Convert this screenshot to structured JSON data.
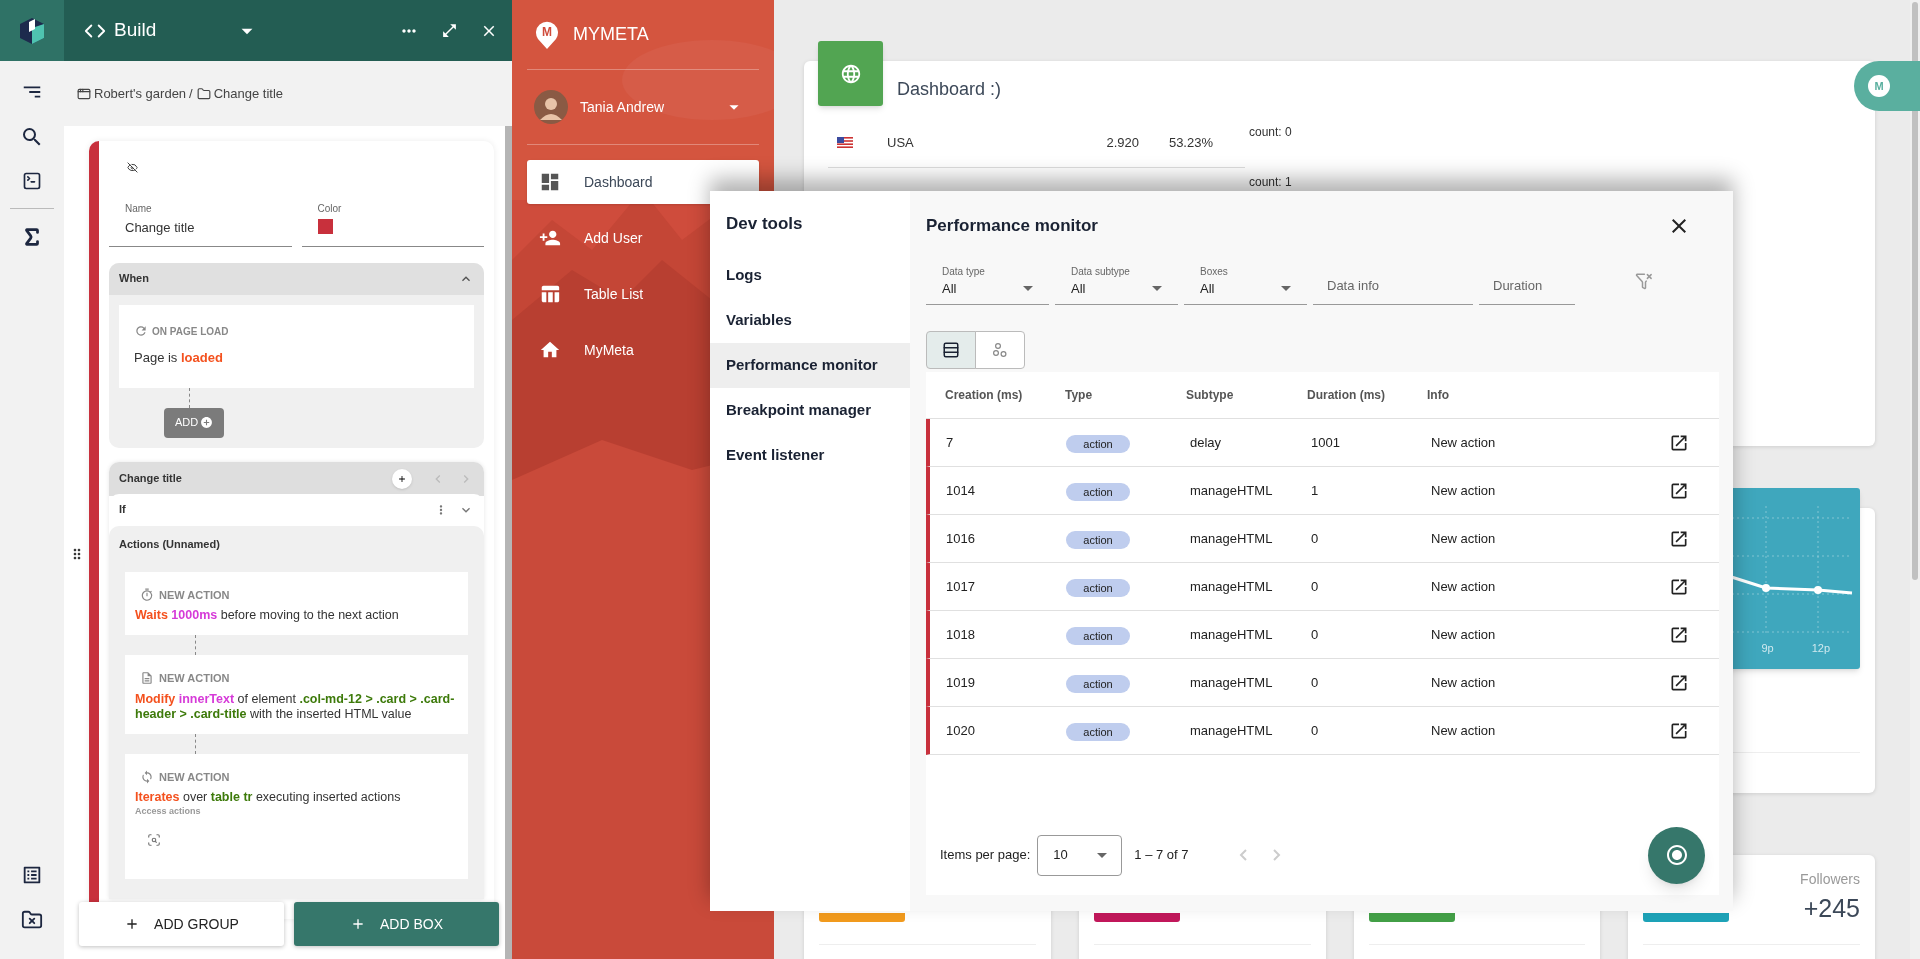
{
  "builder": {
    "title": "Build",
    "breadcrumb": {
      "items": [
        "Robert's garden",
        "Change title"
      ],
      "separator": "/"
    },
    "flow": {
      "name_label": "Name",
      "name_value": "Change title",
      "color_label": "Color",
      "color": "#c8303c",
      "when": {
        "title": "When",
        "expanded": true,
        "trigger": {
          "label": "ON PAGE LOAD",
          "text": [
            {
              "kind": "plain",
              "text": "Page is "
            },
            {
              "kind": "verb",
              "text": "loaded"
            }
          ]
        },
        "add_label": "ADD"
      },
      "group": {
        "title": "Change title",
        "condition": "If",
        "actions_title": "Actions (Unnamed)",
        "actions": [
          {
            "kind": "delay",
            "label": "NEW ACTION",
            "text": [
              {
                "kind": "verb",
                "text": "Waits "
              },
              {
                "kind": "value",
                "text": "1000ms"
              },
              {
                "kind": "plain",
                "text": " before moving to the next action"
              }
            ]
          },
          {
            "kind": "html",
            "label": "NEW ACTION",
            "text": [
              {
                "kind": "verb",
                "text": "Modify "
              },
              {
                "kind": "value",
                "text": "innerText"
              },
              {
                "kind": "plain",
                "text": " of element "
              },
              {
                "kind": "selector",
                "text": ".col-md-12 > .card > .card-header > .card-title"
              },
              {
                "kind": "plain",
                "text": " with the inserted HTML value"
              }
            ]
          },
          {
            "kind": "loop",
            "label": "NEW ACTION",
            "text": [
              {
                "kind": "verb",
                "text": "Iterates"
              },
              {
                "kind": "plain",
                "text": " over "
              },
              {
                "kind": "selector",
                "text": "table tr"
              },
              {
                "kind": "plain",
                "text": " executing inserted actions"
              }
            ],
            "sub": "Access actions"
          }
        ]
      }
    },
    "buttons": [
      {
        "kind": "secondary",
        "label": "ADD GROUP"
      },
      {
        "kind": "primary",
        "label": "ADD BOX"
      }
    ]
  },
  "sidebar": {
    "logo_letter": "M",
    "brand": "MYMETA",
    "user": "Tania Andrew",
    "nav": [
      {
        "kind": "dashboard",
        "label": "Dashboard",
        "selected": true
      },
      {
        "kind": "add_user",
        "label": "Add User",
        "selected": false
      },
      {
        "kind": "table",
        "label": "Table List",
        "selected": false
      },
      {
        "kind": "home",
        "label": "MyMeta",
        "selected": false
      }
    ]
  },
  "dashboard": {
    "title": "Dashboard :)",
    "rows": [
      {
        "country": "USA",
        "value": "2.920",
        "percent": "53.23%",
        "count": "count: 0"
      },
      {
        "count": "count: 1"
      }
    ]
  },
  "chart_card": {
    "labels": [
      "9p",
      "12p"
    ]
  },
  "stat_cards": [
    {
      "color": "#f29b1e"
    },
    {
      "color": "#c2185b"
    },
    {
      "color": "#43a047"
    },
    {
      "color": "#1ea3b8",
      "title": "Followers",
      "value": "+245"
    }
  ],
  "floating_badge": {
    "letter": "M"
  },
  "devtools": {
    "title": "Dev tools",
    "nav": [
      {
        "label": "Logs",
        "selected": false
      },
      {
        "label": "Variables",
        "selected": false
      },
      {
        "label": "Performance monitor",
        "selected": true
      },
      {
        "label": "Breakpoint manager",
        "selected": false
      },
      {
        "label": "Event listener",
        "selected": false
      }
    ],
    "panel": {
      "title": "Performance monitor",
      "filters": [
        {
          "kind": "select",
          "label": "Data type",
          "value": "All"
        },
        {
          "kind": "select",
          "label": "Data subtype",
          "value": "All"
        },
        {
          "kind": "select",
          "label": "Boxes",
          "value": "All"
        },
        {
          "kind": "text",
          "placeholder": "Data info"
        },
        {
          "kind": "text",
          "placeholder": "Duration"
        }
      ],
      "views": [
        {
          "kind": "table",
          "selected": true
        },
        {
          "kind": "graph",
          "selected": false
        }
      ],
      "columns": [
        "Creation (ms)",
        "Type",
        "Subtype",
        "Duration (ms)",
        "Info"
      ],
      "rows": [
        {
          "creation": "7",
          "type": "action",
          "subtype": "delay",
          "duration": "1001",
          "info": "New action"
        },
        {
          "creation": "1014",
          "type": "action",
          "subtype": "manageHTML",
          "duration": "1",
          "info": "New action"
        },
        {
          "creation": "1016",
          "type": "action",
          "subtype": "manageHTML",
          "duration": "0",
          "info": "New action"
        },
        {
          "creation": "1017",
          "type": "action",
          "subtype": "manageHTML",
          "duration": "0",
          "info": "New action"
        },
        {
          "creation": "1018",
          "type": "action",
          "subtype": "manageHTML",
          "duration": "0",
          "info": "New action"
        },
        {
          "creation": "1019",
          "type": "action",
          "subtype": "manageHTML",
          "duration": "0",
          "info": "New action"
        },
        {
          "creation": "1020",
          "type": "action",
          "subtype": "manageHTML",
          "duration": "0",
          "info": "New action"
        }
      ],
      "pagination": {
        "label": "Items per page:",
        "size": "10",
        "range": "1 – 7 of 7",
        "prev_disabled": true,
        "next_disabled": true
      }
    }
  }
}
